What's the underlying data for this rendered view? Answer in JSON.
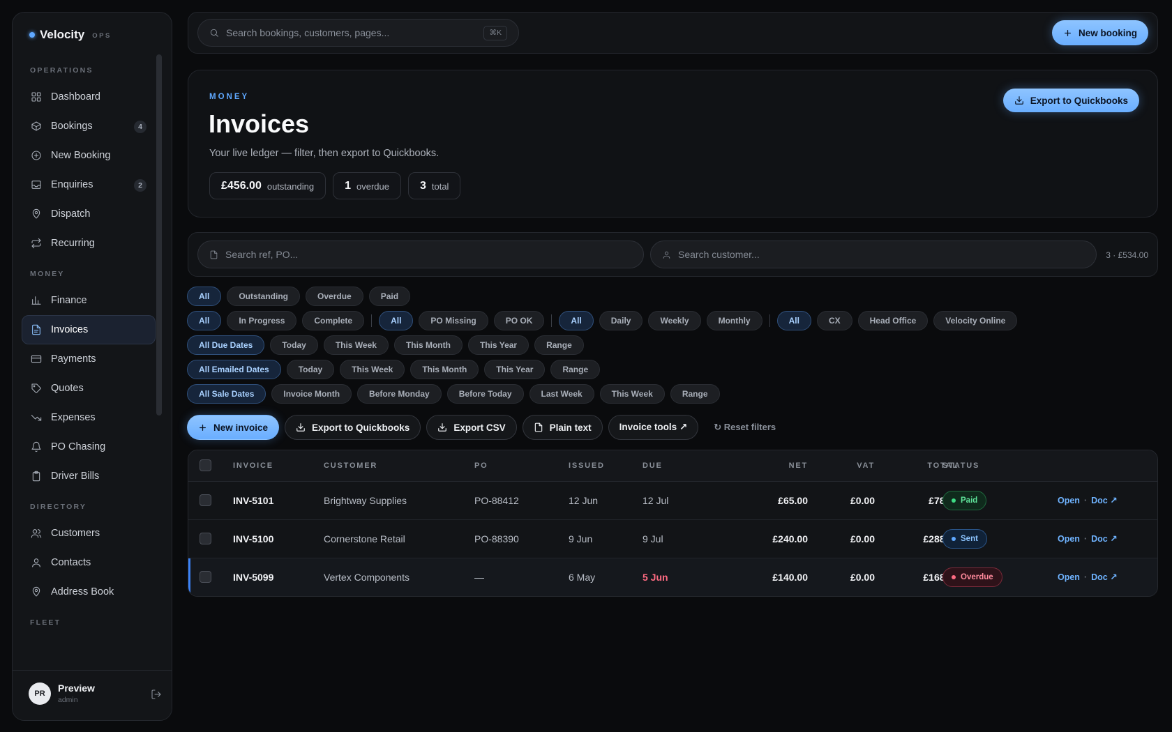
{
  "brand": {
    "name": "Velocity",
    "tag": "OPS"
  },
  "sidebar": {
    "sections": [
      {
        "title": "OPERATIONS",
        "items": [
          {
            "label": "Dashboard",
            "icon": "dashboard-icon"
          },
          {
            "label": "Bookings",
            "icon": "box-icon",
            "badge": "4"
          },
          {
            "label": "New Booking",
            "icon": "plus-circle-icon"
          },
          {
            "label": "Enquiries",
            "icon": "inbox-icon",
            "badge": "2"
          },
          {
            "label": "Dispatch",
            "icon": "map-pin-icon"
          },
          {
            "label": "Recurring",
            "icon": "repeat-icon"
          }
        ]
      },
      {
        "title": "MONEY",
        "items": [
          {
            "label": "Finance",
            "icon": "bar-chart-icon"
          },
          {
            "label": "Invoices",
            "icon": "file-text-icon",
            "active": true
          },
          {
            "label": "Payments",
            "icon": "credit-card-icon"
          },
          {
            "label": "Quotes",
            "icon": "tag-icon"
          },
          {
            "label": "Expenses",
            "icon": "trending-down-icon"
          },
          {
            "label": "PO Chasing",
            "icon": "bell-icon"
          },
          {
            "label": "Driver Bills",
            "icon": "clipboard-icon"
          }
        ]
      },
      {
        "title": "DIRECTORY",
        "items": [
          {
            "label": "Customers",
            "icon": "users-icon"
          },
          {
            "label": "Contacts",
            "icon": "user-icon"
          },
          {
            "label": "Address Book",
            "icon": "map-pin-icon"
          }
        ]
      },
      {
        "title": "FLEET",
        "items": []
      }
    ],
    "user": {
      "initials": "PR",
      "name": "Preview",
      "role": "admin"
    }
  },
  "topbar": {
    "search_placeholder": "Search bookings, customers, pages...",
    "shortcut": "⌘K",
    "new_booking": "New booking"
  },
  "hero": {
    "eyebrow": "MONEY",
    "title": "Invoices",
    "subtitle": "Your live ledger — filter, then export to Quickbooks.",
    "export_label": "Export to Quickbooks",
    "stats": [
      {
        "value": "£456.00",
        "label": "outstanding"
      },
      {
        "value": "1",
        "label": "overdue"
      },
      {
        "value": "3",
        "label": "total"
      }
    ]
  },
  "filters": {
    "ref_placeholder": "Search ref, PO...",
    "customer_placeholder": "Search customer...",
    "summary": "3 · £534.00",
    "rows": [
      [
        [
          "All",
          "Outstanding",
          "Overdue",
          "Paid"
        ]
      ],
      [
        [
          "All",
          "In Progress",
          "Complete"
        ],
        [
          "All",
          "PO Missing",
          "PO OK"
        ],
        [
          "All",
          "Daily",
          "Weekly",
          "Monthly"
        ],
        [
          "All",
          "CX",
          "Head Office",
          "Velocity Online"
        ]
      ],
      [
        [
          "All Due Dates",
          "Today",
          "This Week",
          "This Month",
          "This Year",
          "Range"
        ]
      ],
      [
        [
          "All Emailed Dates",
          "Today",
          "This Week",
          "This Month",
          "This Year",
          "Range"
        ]
      ],
      [
        [
          "All Sale Dates",
          "Invoice Month",
          "Before Monday",
          "Before Today",
          "Last Week",
          "This Week",
          "Range"
        ]
      ]
    ]
  },
  "actions": {
    "new_invoice": "New invoice",
    "export_quickbooks": "Export to Quickbooks",
    "export_csv": "Export CSV",
    "plain_text": "Plain text",
    "invoice_tools": "Invoice tools ↗",
    "reset": "↻ Reset filters"
  },
  "table": {
    "headers": {
      "invoice": "INVOICE",
      "customer": "CUSTOMER",
      "po": "PO",
      "issued": "ISSUED",
      "due": "DUE",
      "net": "NET",
      "vat": "VAT",
      "total": "TOTAL",
      "status": "STATUS"
    },
    "rows": [
      {
        "invoice": "INV-5101",
        "customer": "Brightway Supplies",
        "po": "PO-88412",
        "issued": "12 Jun",
        "due": "12 Jul",
        "net": "£65.00",
        "vat": "£0.00",
        "total": "£78.00",
        "status": "Paid",
        "open": "Open",
        "doc": "Doc ↗"
      },
      {
        "invoice": "INV-5100",
        "customer": "Cornerstone Retail",
        "po": "PO-88390",
        "issued": "9 Jun",
        "due": "9 Jul",
        "net": "£240.00",
        "vat": "£0.00",
        "total": "£288.00",
        "status": "Sent",
        "open": "Open",
        "doc": "Doc ↗"
      },
      {
        "invoice": "INV-5099",
        "customer": "Vertex Components",
        "po": "—",
        "issued": "6 May",
        "due": "5 Jun",
        "net": "£140.00",
        "vat": "£0.00",
        "total": "£168.00",
        "status": "Overdue",
        "open": "Open",
        "doc": "Doc ↗"
      }
    ]
  },
  "colors": {
    "accent": "#6aaeff",
    "paid": "#3ddc84",
    "sent": "#5fa8ff",
    "overdue": "#ff6b82"
  }
}
